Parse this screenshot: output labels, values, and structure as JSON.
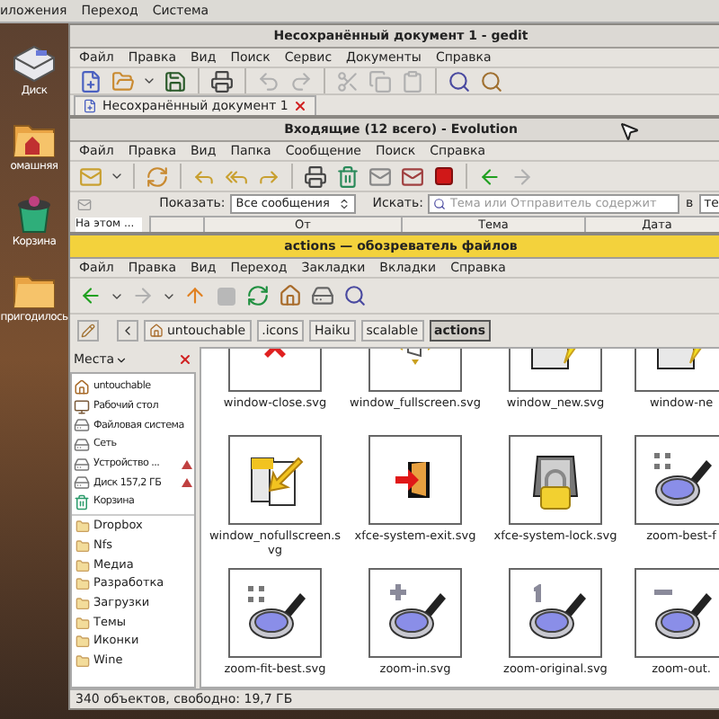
{
  "top_panel": {
    "menus": [
      "иложения",
      "Переход",
      "Система"
    ]
  },
  "desktop_icons": [
    {
      "label": "Диск",
      "kind": "drive"
    },
    {
      "label": "омашняя",
      "kind": "home"
    },
    {
      "label": "Корзина",
      "kind": "trash"
    },
    {
      "label": "пригодилось",
      "kind": "folder"
    }
  ],
  "gedit": {
    "title": "Несохранённый документ 1 - gedit",
    "menu": [
      "Файл",
      "Правка",
      "Вид",
      "Поиск",
      "Сервис",
      "Документы",
      "Справка"
    ],
    "tab": {
      "label": "Несохранённый документ 1"
    }
  },
  "evolution": {
    "title": "Входящие (12 всего) - Evolution",
    "menu": [
      "Файл",
      "Правка",
      "Вид",
      "Папка",
      "Сообщение",
      "Поиск",
      "Справка"
    ],
    "show_label": "Показать:",
    "show_value": "Все сообщения",
    "search_label": "Искать:",
    "search_placeholder": "Тема или Отправитель содержит",
    "in_label": "в",
    "scope_value": "те",
    "folder_pane": "На этом ...",
    "columns": [
      "От",
      "Тема",
      "Дата"
    ]
  },
  "nautilus": {
    "title": "actions — обозреватель файлов",
    "menu": [
      "Файл",
      "Правка",
      "Вид",
      "Переход",
      "Закладки",
      "Вкладки",
      "Справка"
    ],
    "path": [
      {
        "label": "untouchable",
        "selected": false,
        "kind": "home"
      },
      {
        "label": ".icons",
        "selected": false,
        "kind": "plain"
      },
      {
        "label": "Haiku",
        "selected": false,
        "kind": "plain"
      },
      {
        "label": "scalable",
        "selected": false,
        "kind": "plain"
      },
      {
        "label": "actions",
        "selected": true,
        "kind": "plain"
      }
    ],
    "sidebar": {
      "title": "Места",
      "places": [
        {
          "label": "untouchable",
          "kind": "home",
          "eject": false
        },
        {
          "label": "Рабочий стол",
          "kind": "desktop",
          "eject": false
        },
        {
          "label": "Файловая система",
          "kind": "drive",
          "eject": false
        },
        {
          "label": "Сеть",
          "kind": "drive",
          "eject": false
        },
        {
          "label": "Устройство ...",
          "kind": "drive",
          "eject": true
        },
        {
          "label": "Диск 157,2 ГБ",
          "kind": "drive",
          "eject": true
        },
        {
          "label": "Корзина",
          "kind": "trash",
          "eject": false
        }
      ],
      "bookmarks": [
        "Dropbox",
        "Nfs",
        "Медиа",
        "Разработка",
        "Загрузки",
        "Темы",
        "Иконки",
        "Wine"
      ]
    },
    "files": [
      {
        "name": "window-close.svg",
        "kind": "close"
      },
      {
        "name": "window_fullscreen.svg",
        "kind": "fullscreen"
      },
      {
        "name": "window_new.svg",
        "kind": "folder-new"
      },
      {
        "name": "window-ne",
        "kind": "folder-new"
      },
      {
        "name": "window_nofullscreen.svg",
        "kind": "nofullscreen"
      },
      {
        "name": "xfce-system-exit.svg",
        "kind": "exit"
      },
      {
        "name": "xfce-system-lock.svg",
        "kind": "lock"
      },
      {
        "name": "zoom-best-f",
        "kind": "zoom-best"
      },
      {
        "name": "zoom-fit-best.svg",
        "kind": "zoom-best"
      },
      {
        "name": "zoom-in.svg",
        "kind": "zoom-in"
      },
      {
        "name": "zoom-original.svg",
        "kind": "zoom-original"
      },
      {
        "name": "zoom-out.",
        "kind": "zoom-out"
      }
    ],
    "status": "340 объектов, свободно: 19,7 ГБ"
  }
}
